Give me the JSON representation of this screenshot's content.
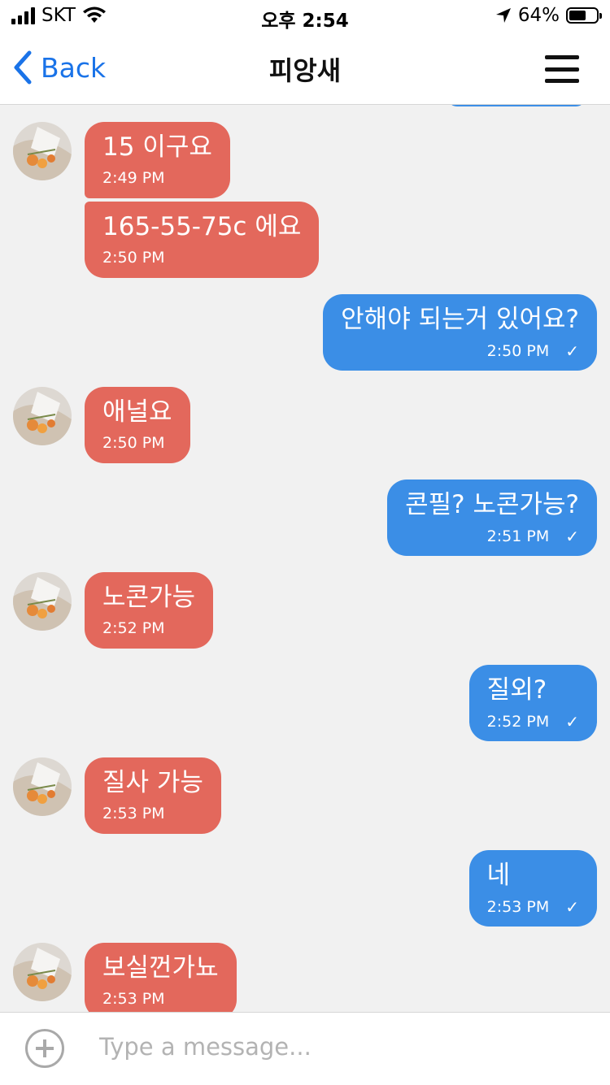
{
  "status_bar": {
    "carrier": "SKT",
    "time": "오후 2:54",
    "battery_percent": "64%",
    "battery_level": 0.64,
    "icons": [
      "signal-icon",
      "wifi-icon",
      "location-arrow-icon",
      "battery-icon"
    ]
  },
  "nav": {
    "back_label": "Back",
    "title": "피앙새",
    "menu_icon": "hamburger-menu-icon"
  },
  "messages": [
    {
      "side": "received",
      "text": "15 이구요",
      "time": "2:49 PM"
    },
    {
      "side": "received",
      "text": "165-55-75c 에요",
      "time": "2:50 PM"
    },
    {
      "side": "sent",
      "text": "안해야 되는거 있어요?",
      "time": "2:50 PM",
      "read_mark": "✓"
    },
    {
      "side": "received",
      "text": "애널요",
      "time": "2:50 PM"
    },
    {
      "side": "sent",
      "text": "콘필? 노콘가능?",
      "time": "2:51 PM",
      "read_mark": "✓"
    },
    {
      "side": "received",
      "text": "노콘가능",
      "time": "2:52 PM"
    },
    {
      "side": "sent",
      "text": "질외?",
      "time": "2:52 PM",
      "read_mark": "✓"
    },
    {
      "side": "received",
      "text": "질사 가능",
      "time": "2:53 PM"
    },
    {
      "side": "sent",
      "text": "네",
      "time": "2:53 PM",
      "read_mark": "✓"
    },
    {
      "side": "received",
      "text": "보실껀가뇨",
      "time": "2:53 PM"
    }
  ],
  "composer": {
    "placeholder": "Type a message...",
    "value": ""
  },
  "colors": {
    "received_bubble": "#e3685c",
    "sent_bubble": "#3b8ee6",
    "accent": "#1a73e8",
    "background": "#f1f1f1"
  }
}
